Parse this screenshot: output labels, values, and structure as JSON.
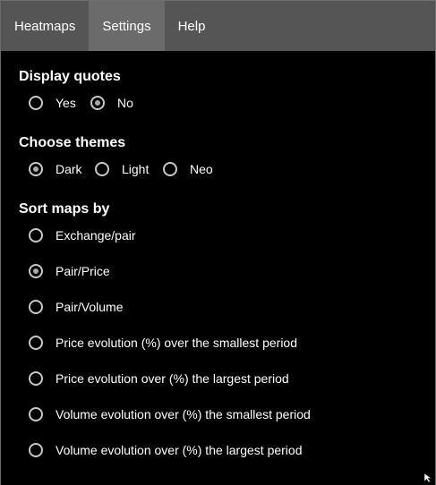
{
  "menu": {
    "tabs": [
      {
        "label": "Heatmaps"
      },
      {
        "label": "Settings"
      },
      {
        "label": "Help"
      }
    ],
    "active_tab": "Settings"
  },
  "display_quotes": {
    "title": "Display quotes",
    "options": [
      {
        "label": "Yes",
        "checked": false
      },
      {
        "label": "No",
        "checked": true
      }
    ]
  },
  "themes": {
    "title": "Choose themes",
    "options": [
      {
        "label": "Dark",
        "checked": true
      },
      {
        "label": "Light",
        "checked": false
      },
      {
        "label": "Neo",
        "checked": false
      }
    ]
  },
  "sort": {
    "title": "Sort maps by",
    "options": [
      {
        "label": "Exchange/pair",
        "checked": false
      },
      {
        "label": "Pair/Price",
        "checked": true
      },
      {
        "label": "Pair/Volume",
        "checked": false
      },
      {
        "label": "Price evolution (%) over the smallest period",
        "checked": false
      },
      {
        "label": "Price evolution over (%) the largest period",
        "checked": false
      },
      {
        "label": "Volume evolution over (%) the smallest period",
        "checked": false
      },
      {
        "label": "Volume evolution over (%) the largest period",
        "checked": false
      }
    ]
  },
  "colors": {
    "background": "#000000",
    "menubar": "#555555",
    "menubar_active": "#6b6b6b",
    "radio_border": "#c8c8c8",
    "radio_dot": "#aaaaaa"
  }
}
